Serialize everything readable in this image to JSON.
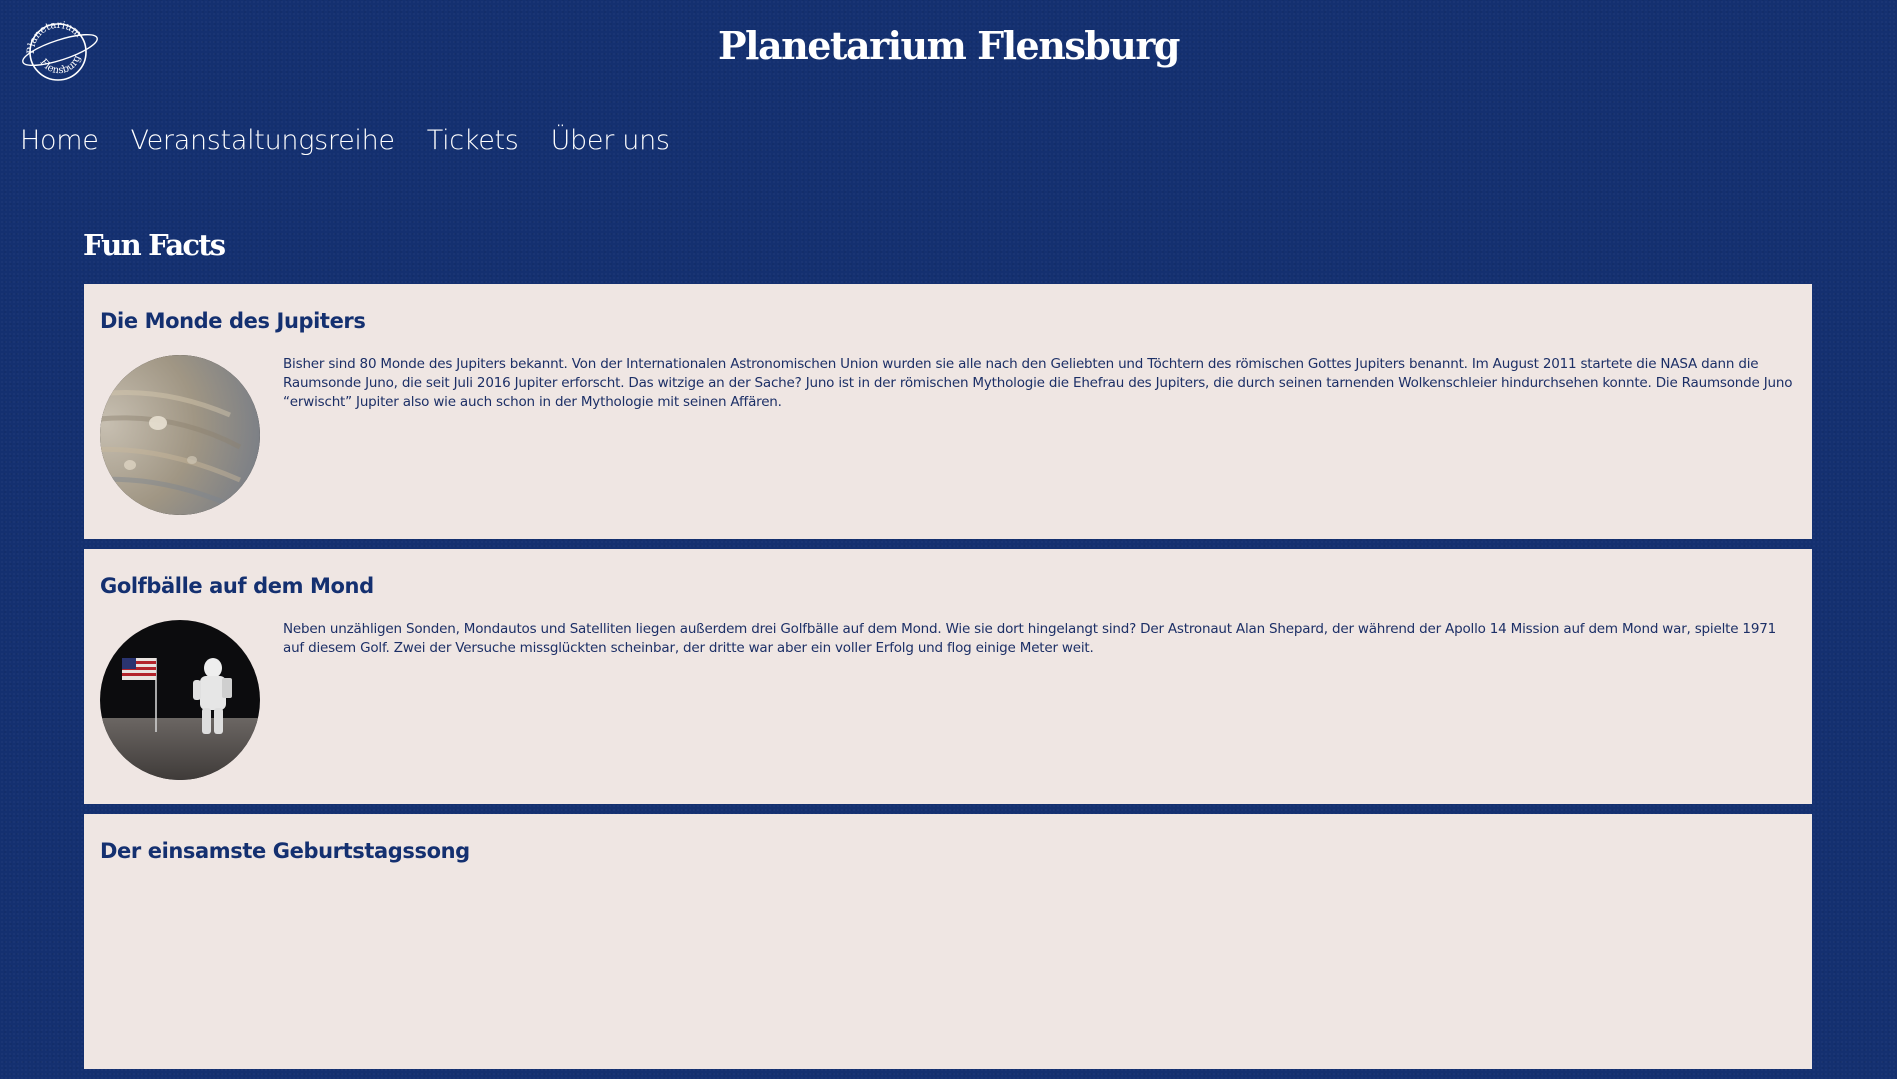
{
  "header": {
    "logo": {
      "icon": "planetarium-logo",
      "text_top": "Planetarium",
      "text_bottom": "Flensburg"
    },
    "title": "Planetarium Flensburg"
  },
  "nav": {
    "items": [
      {
        "label": "Home"
      },
      {
        "label": "Veranstaltungsreihe"
      },
      {
        "label": "Tickets"
      },
      {
        "label": "Über uns"
      }
    ]
  },
  "main": {
    "section_title": "Fun Facts",
    "cards": [
      {
        "title": "Die Monde des Jupiters",
        "image": "jupiter-photo",
        "text": "Bisher sind 80 Monde des Jupiters bekannt. Von der Internationalen Astronomischen Union wurden sie alle nach den Geliebten und Töchtern des römischen Gottes Jupiters benannt. Im August 2011 startete die NASA dann die Raumsonde Juno, die seit Juli 2016 Jupiter erforscht. Das witzige an der Sache? Juno ist in der römischen Mythologie die Ehefrau des Jupiters, die durch seinen tarnenden Wolkenschleier hindurchsehen konnte. Die Raumsonde Juno “erwischt” Jupiter also wie auch schon in der Mythologie mit seinen Affären."
      },
      {
        "title": "Golfbälle auf dem Mond",
        "image": "astronaut-on-moon-photo",
        "text": "Neben unzähligen Sonden, Mondautos und Satelliten liegen außerdem drei Golfbälle auf dem Mond. Wie sie dort hingelangt sind? Der Astronaut Alan Shepard, der während der Apollo 14 Mission auf dem Mond war, spielte 1971 auf diesem Golf. Zwei der Versuche missglückten scheinbar, der dritte war aber ein voller Erfolg und flog einige Meter weit."
      },
      {
        "title": "Der einsamste Geburtstagssong",
        "image": "",
        "text": ""
      }
    ]
  },
  "colors": {
    "background": "#143070",
    "card_background": "#efe6e3",
    "accent_text": "#143070"
  }
}
